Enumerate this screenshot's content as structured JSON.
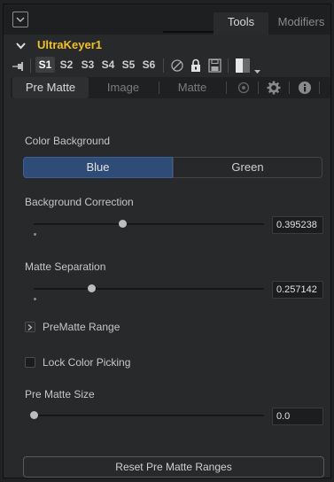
{
  "header": {
    "tabs": [
      {
        "label": "Tools",
        "active": true
      },
      {
        "label": "Modifiers",
        "active": false
      }
    ]
  },
  "node": {
    "name": "UltraKeyer1",
    "name_color": "#f0c02a"
  },
  "versions": [
    "S1",
    "S2",
    "S3",
    "S4",
    "S5",
    "S6"
  ],
  "active_version": "S1",
  "version_icons": [
    "reset-icon",
    "lock-icon",
    "save-icon",
    "color-swatch-icon",
    "dropdown-arrow-icon"
  ],
  "subtabs": [
    {
      "label": "Pre Matte",
      "active": true
    },
    {
      "label": "Image",
      "active": false
    },
    {
      "label": "Matte",
      "active": false
    },
    {
      "icon": "spline-icon"
    },
    {
      "icon": "settings-gear-icon"
    },
    {
      "icon": "info-icon"
    }
  ],
  "color_background": {
    "label": "Color Background",
    "options": [
      "Blue",
      "Green"
    ],
    "selected": "Blue",
    "selected_color": "#2f4b78"
  },
  "background_correction": {
    "label": "Background Correction",
    "value": "0.395238",
    "slider_fraction": 0.395
  },
  "matte_separation": {
    "label": "Matte Separation",
    "value": "0.257142",
    "slider_fraction": 0.257
  },
  "prematte_range": {
    "label": "PreMatte Range",
    "checked": false
  },
  "lock_color_picking": {
    "label": "Lock Color Picking",
    "checked": false
  },
  "pre_matte_size": {
    "label": "Pre Matte Size",
    "value": "0.0",
    "slider_fraction": 0.0
  },
  "reset_button": {
    "label": "Reset Pre Matte Ranges"
  }
}
